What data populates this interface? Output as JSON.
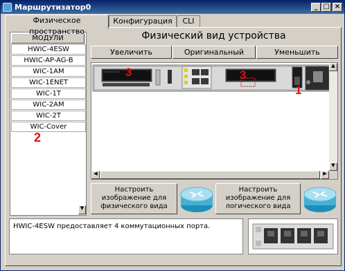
{
  "window": {
    "title": "Маршрутизатор0",
    "controls": {
      "minimize": "_",
      "maximize": "□",
      "close": "×"
    }
  },
  "tabs": [
    {
      "label": "Физическое пространство",
      "active": true
    },
    {
      "label": "Конфигурация",
      "active": false
    },
    {
      "label": "CLI",
      "active": false
    }
  ],
  "modules": {
    "header": "МОДУЛИ",
    "items": [
      "HWIC-4ESW",
      "HWIC-AP-AG-B",
      "WIC-1AM",
      "WIC-1ENET",
      "WIC-1T",
      "WIC-2AM",
      "WIC-2T",
      "WIC-Cover"
    ]
  },
  "physical_view": {
    "title": "Физический вид устройства",
    "zoom_in": "Увеличить",
    "original_size": "Оригинальный размер",
    "zoom_out": "Уменьшить"
  },
  "annotations": {
    "slot_left": "3",
    "slot_right": "3",
    "power_switch": "1",
    "module_list": "2"
  },
  "customize": {
    "physical": "Настроить изображение для физического вида",
    "logical": "Настроить изображение для логического вида"
  },
  "description": "HWIC-4ESW предоставляет 4 коммутационных порта.",
  "icons": {
    "app": "router-app-icon",
    "router": "router-icon"
  }
}
